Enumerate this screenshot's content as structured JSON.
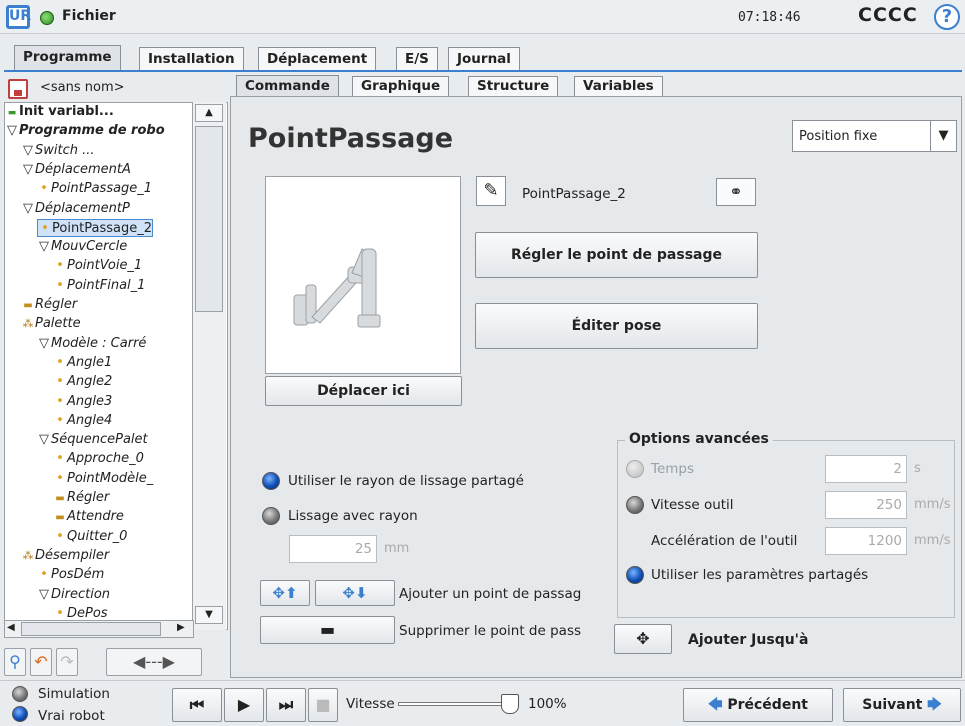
{
  "header": {
    "app_menu": "Fichier",
    "clock": "07:18:46",
    "robot_name": "CCCC",
    "help_glyph": "?",
    "logo": "UR"
  },
  "main_tabs": [
    {
      "label": "Programme",
      "active": true
    },
    {
      "label": "Installation"
    },
    {
      "label": "Déplacement"
    },
    {
      "label": "E/S"
    },
    {
      "label": "Journal"
    }
  ],
  "program": {
    "name": "<sans nom>"
  },
  "tree": [
    {
      "label": "Init variabl...",
      "style": "bold",
      "marker": "green-bar"
    },
    {
      "label": "Programme de robo",
      "style": "bold-italic",
      "marker": "triangle"
    },
    {
      "label": "Switch ...",
      "style": "italic",
      "marker": "triangle"
    },
    {
      "label": "DéplacementA",
      "style": "italic",
      "marker": "triangle"
    },
    {
      "label": "PointPassage_1",
      "style": "italic",
      "marker": "dot"
    },
    {
      "label": "DéplacementP",
      "style": "italic",
      "marker": "triangle"
    },
    {
      "label": "PointPassage_2",
      "style": "normal",
      "marker": "dot",
      "selected": true
    },
    {
      "label": "MouvCercle",
      "style": "italic",
      "marker": "triangle"
    },
    {
      "label": "PointVoie_1",
      "style": "italic",
      "marker": "dot"
    },
    {
      "label": "PointFinal_1",
      "style": "italic",
      "marker": "dot"
    },
    {
      "label": "Régler",
      "style": "italic",
      "marker": "bar"
    },
    {
      "label": "Palette",
      "style": "italic",
      "marker": "cluster"
    },
    {
      "label": "Modèle : Carré",
      "style": "italic",
      "marker": "triangle"
    },
    {
      "label": "Angle1",
      "style": "italic",
      "marker": "dot"
    },
    {
      "label": "Angle2",
      "style": "italic",
      "marker": "dot"
    },
    {
      "label": "Angle3",
      "style": "italic",
      "marker": "dot"
    },
    {
      "label": "Angle4",
      "style": "italic",
      "marker": "dot"
    },
    {
      "label": "SéquencePalet",
      "style": "italic",
      "marker": "triangle"
    },
    {
      "label": "Approche_0",
      "style": "italic",
      "marker": "dot"
    },
    {
      "label": "PointModèle_",
      "style": "italic",
      "marker": "dot"
    },
    {
      "label": "Régler",
      "style": "italic",
      "marker": "bar"
    },
    {
      "label": "Attendre",
      "style": "italic",
      "marker": "bar"
    },
    {
      "label": "Quitter_0",
      "style": "italic",
      "marker": "dot"
    },
    {
      "label": "Désempiler",
      "style": "italic",
      "marker": "cluster"
    },
    {
      "label": "PosDém",
      "style": "italic",
      "marker": "dot"
    },
    {
      "label": "Direction",
      "style": "italic",
      "marker": "triangle"
    },
    {
      "label": "DePos",
      "style": "italic",
      "marker": "dot"
    }
  ],
  "sub_tabs": [
    {
      "label": "Commande",
      "active": true
    },
    {
      "label": "Graphique"
    },
    {
      "label": "Structure"
    },
    {
      "label": "Variables"
    }
  ],
  "panel": {
    "title": "PointPassage",
    "position_type": "Position fixe",
    "waypoint_name": "PointPassage_2",
    "set_waypoint_button": "Régler le point de passage",
    "edit_pose_button": "Éditer pose",
    "move_here_button": "Déplacer ici"
  },
  "blend": {
    "shared_radius_label": "Utiliser le rayon de lissage partagé",
    "radius_label": "Lissage avec rayon",
    "radius_value": "25",
    "radius_unit": "mm"
  },
  "waypoint_actions": {
    "add_label": "Ajouter un point de passag",
    "remove_label": "Supprimer le point de pass"
  },
  "advanced": {
    "title": "Options avancées",
    "time_label": "Temps",
    "time_value": "2",
    "time_unit": "s",
    "speed_label": "Vitesse outil",
    "speed_value": "250",
    "speed_unit": "mm/s",
    "accel_label": "Accélération de l'outil",
    "accel_value": "1200",
    "accel_unit": "mm/s",
    "shared_params_label": "Utiliser les paramètres partagés"
  },
  "add_until": {
    "label": "Ajouter Jusqu'à"
  },
  "footer": {
    "simulation_label": "Simulation",
    "real_robot_label": "Vrai robot",
    "speed_label": "Vitesse",
    "speed_value": "100%",
    "speed_fraction": 1.0,
    "prev_label": "Précédent",
    "next_label": "Suivant"
  },
  "colors": {
    "accent": "#3b7fd0",
    "selected": "#cfe2f7",
    "tree_dot": "#e0a020"
  }
}
